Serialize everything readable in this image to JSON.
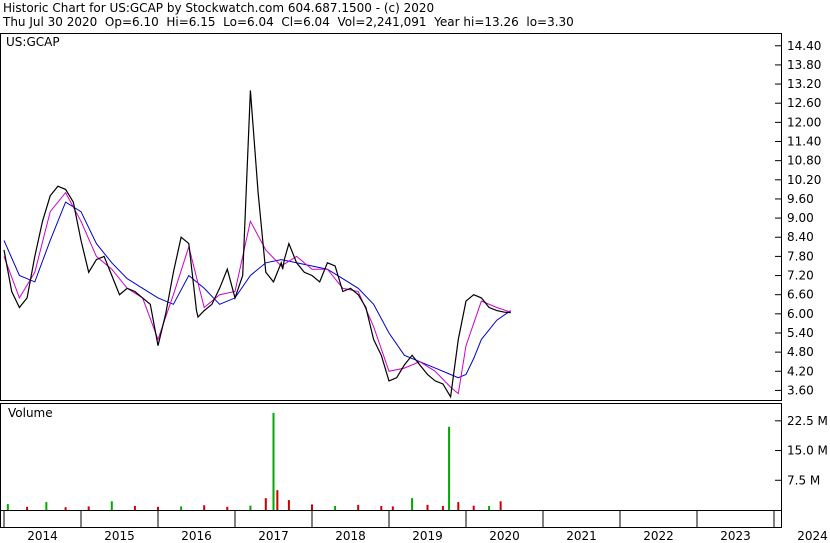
{
  "header": {
    "title": "Historic Chart for US:GCAP by Stockwatch.com 604.687.1500 - (c) 2020",
    "stats": "Thu Jul 30 2020  Op=6.10  Hi=6.15  Lo=6.04  Cl=6.04  Vol=2,241,091  Year hi=13.26  lo=3.30"
  },
  "colors": {
    "price": "#000000",
    "ma_short": "#cc00cc",
    "ma_long": "#0000cc",
    "volume_up": "#00aa00",
    "volume_down": "#cc0000",
    "grid": "#000000"
  },
  "chart_data": [
    {
      "type": "line",
      "title": "US:GCAP",
      "ylim": [
        3.3,
        14.8
      ],
      "yticks": [
        "14.40",
        "13.80",
        "13.20",
        "12.60",
        "12.00",
        "11.40",
        "10.80",
        "10.20",
        "9.60",
        "9.00",
        "8.40",
        "7.80",
        "7.20",
        "6.60",
        "6.00",
        "5.40",
        "4.80",
        "4.20",
        "3.60"
      ],
      "xlabels": [
        "2014",
        "2015",
        "2016",
        "2017",
        "2018",
        "2019",
        "2020",
        "2021",
        "2022",
        "2023",
        "2024"
      ],
      "series": [
        {
          "role": "close",
          "x": [
            2014.0,
            2014.1,
            2014.2,
            2014.3,
            2014.4,
            2014.5,
            2014.6,
            2014.7,
            2014.8,
            2014.9,
            2015.0,
            2015.1,
            2015.2,
            2015.3,
            2015.4,
            2015.5,
            2015.6,
            2015.7,
            2015.8,
            2015.9,
            2016.0,
            2016.1,
            2016.2,
            2016.3,
            2016.4,
            2016.5,
            2016.52,
            2016.6,
            2016.7,
            2016.8,
            2016.9,
            2017.0,
            2017.1,
            2017.2,
            2017.3,
            2017.4,
            2017.5,
            2017.6,
            2017.62,
            2017.64,
            2017.7,
            2017.8,
            2017.9,
            2018.0,
            2018.1,
            2018.2,
            2018.3,
            2018.4,
            2018.5,
            2018.6,
            2018.7,
            2018.8,
            2018.9,
            2019.0,
            2019.1,
            2019.2,
            2019.3,
            2019.4,
            2019.5,
            2019.6,
            2019.7,
            2019.8,
            2019.9,
            2020.0,
            2020.1,
            2020.2,
            2020.3,
            2020.4,
            2020.5,
            2020.58
          ],
          "values": [
            8.0,
            6.7,
            6.2,
            6.5,
            7.8,
            8.9,
            9.7,
            10.0,
            9.9,
            9.5,
            8.3,
            7.3,
            7.7,
            7.8,
            7.2,
            6.6,
            6.8,
            6.7,
            6.5,
            6.3,
            5.0,
            6.0,
            7.3,
            8.4,
            8.2,
            6.1,
            5.9,
            6.1,
            6.3,
            6.8,
            7.4,
            6.5,
            7.2,
            13.0,
            9.8,
            7.3,
            7.0,
            7.6,
            7.4,
            7.7,
            8.2,
            7.6,
            7.3,
            7.2,
            7.0,
            7.6,
            7.5,
            6.7,
            6.8,
            6.6,
            6.2,
            5.2,
            4.7,
            3.9,
            4.0,
            4.4,
            4.7,
            4.4,
            4.1,
            3.9,
            3.8,
            3.4,
            5.2,
            6.4,
            6.6,
            6.5,
            6.2,
            6.1,
            6.05,
            6.04
          ]
        },
        {
          "role": "short moving average",
          "x": [
            2014.0,
            2014.2,
            2014.4,
            2014.6,
            2014.8,
            2015.0,
            2015.2,
            2015.4,
            2015.6,
            2015.8,
            2016.0,
            2016.2,
            2016.4,
            2016.6,
            2016.8,
            2017.0,
            2017.2,
            2017.4,
            2017.6,
            2017.8,
            2018.0,
            2018.2,
            2018.4,
            2018.6,
            2018.8,
            2019.0,
            2019.2,
            2019.4,
            2019.6,
            2019.8,
            2019.9,
            2020.0,
            2020.2,
            2020.4,
            2020.58
          ],
          "values": [
            7.8,
            6.5,
            7.3,
            9.2,
            9.8,
            8.9,
            7.8,
            7.4,
            6.8,
            6.5,
            5.2,
            6.6,
            8.1,
            6.2,
            6.6,
            6.7,
            8.9,
            8.0,
            7.5,
            7.8,
            7.4,
            7.4,
            6.8,
            6.7,
            5.6,
            4.2,
            4.3,
            4.5,
            4.2,
            3.7,
            3.5,
            5.0,
            6.4,
            6.2,
            6.05
          ]
        },
        {
          "role": "long moving average",
          "x": [
            2014.0,
            2014.2,
            2014.4,
            2014.6,
            2014.8,
            2015.0,
            2015.2,
            2015.4,
            2015.6,
            2015.8,
            2016.0,
            2016.2,
            2016.4,
            2016.6,
            2016.8,
            2017.0,
            2017.2,
            2017.4,
            2017.6,
            2017.8,
            2018.0,
            2018.2,
            2018.4,
            2018.6,
            2018.8,
            2019.0,
            2019.2,
            2019.4,
            2019.6,
            2019.8,
            2019.9,
            2020.0,
            2020.1,
            2020.2,
            2020.4,
            2020.58
          ],
          "values": [
            8.3,
            7.2,
            7.0,
            8.3,
            9.5,
            9.2,
            8.2,
            7.6,
            7.1,
            6.8,
            6.5,
            6.3,
            7.2,
            6.8,
            6.3,
            6.5,
            7.2,
            7.6,
            7.7,
            7.6,
            7.5,
            7.4,
            7.1,
            6.8,
            6.3,
            5.4,
            4.7,
            4.5,
            4.3,
            4.1,
            4.0,
            4.1,
            4.6,
            5.2,
            5.8,
            6.1
          ]
        }
      ]
    },
    {
      "type": "bar",
      "title": "Volume",
      "ylim": [
        0,
        27
      ],
      "ytick_values": [
        22.5,
        15.0,
        7.5
      ],
      "yticks": [
        "22.5 M",
        "15.0 M",
        "7.5 M"
      ],
      "x": [
        2014.05,
        2014.3,
        2014.55,
        2014.8,
        2015.1,
        2015.4,
        2015.7,
        2016.0,
        2016.3,
        2016.6,
        2016.9,
        2017.2,
        2017.4,
        2017.5,
        2017.55,
        2017.7,
        2018.0,
        2018.3,
        2018.6,
        2018.9,
        2019.05,
        2019.3,
        2019.5,
        2019.7,
        2019.78,
        2019.9,
        2020.1,
        2020.3,
        2020.45
      ],
      "values": [
        1.5,
        0.8,
        2.0,
        0.7,
        0.9,
        2.2,
        1.0,
        0.8,
        0.9,
        1.2,
        0.8,
        1.1,
        3.0,
        24.5,
        5.0,
        2.5,
        1.4,
        1.0,
        1.3,
        1.0,
        0.9,
        3.0,
        1.3,
        1.0,
        21.0,
        2.0,
        1.1,
        1.0,
        2.2
      ],
      "colors": [
        "up",
        "down",
        "up",
        "down",
        "down",
        "up",
        "down",
        "down",
        "up",
        "down",
        "down",
        "up",
        "down",
        "up",
        "down",
        "down",
        "down",
        "up",
        "down",
        "down",
        "down",
        "up",
        "down",
        "down",
        "up",
        "down",
        "down",
        "up",
        "down"
      ]
    }
  ]
}
